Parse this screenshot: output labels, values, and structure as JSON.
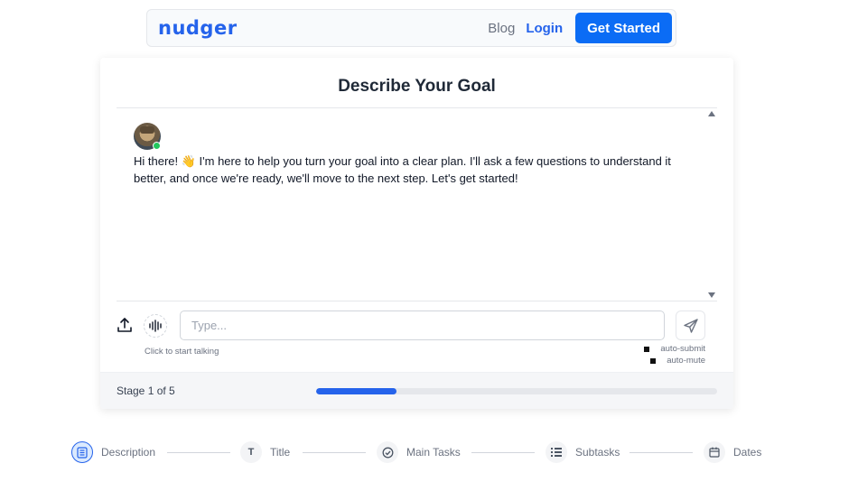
{
  "navbar": {
    "logo": "nudger",
    "blog": "Blog",
    "login": "Login",
    "cta": "Get Started"
  },
  "card": {
    "title": "Describe Your Goal",
    "message": "Hi there! 👋 I'm here to help you turn your goal into a clear plan. I'll ask a few questions to understand it better, and once we're ready, we'll move to the next step. Let's get started!"
  },
  "input": {
    "placeholder": "Type...",
    "value": "",
    "hint": "Click to start talking",
    "auto_submit": "auto-submit",
    "auto_mute": "auto-mute"
  },
  "progress": {
    "stage_label": "Stage 1 of 5",
    "fraction": 0.2
  },
  "stepper": {
    "steps": [
      {
        "label": "Description",
        "icon": "document-list-icon",
        "active": true
      },
      {
        "label": "Title",
        "icon": "text-t-icon",
        "active": false
      },
      {
        "label": "Main Tasks",
        "icon": "check-circle-icon",
        "active": false
      },
      {
        "label": "Subtasks",
        "icon": "list-bullets-icon",
        "active": false
      },
      {
        "label": "Dates",
        "icon": "calendar-icon",
        "active": false
      }
    ]
  },
  "colors": {
    "accent": "#2563eb",
    "cta": "#0b6cf5",
    "online": "#22c55e"
  }
}
